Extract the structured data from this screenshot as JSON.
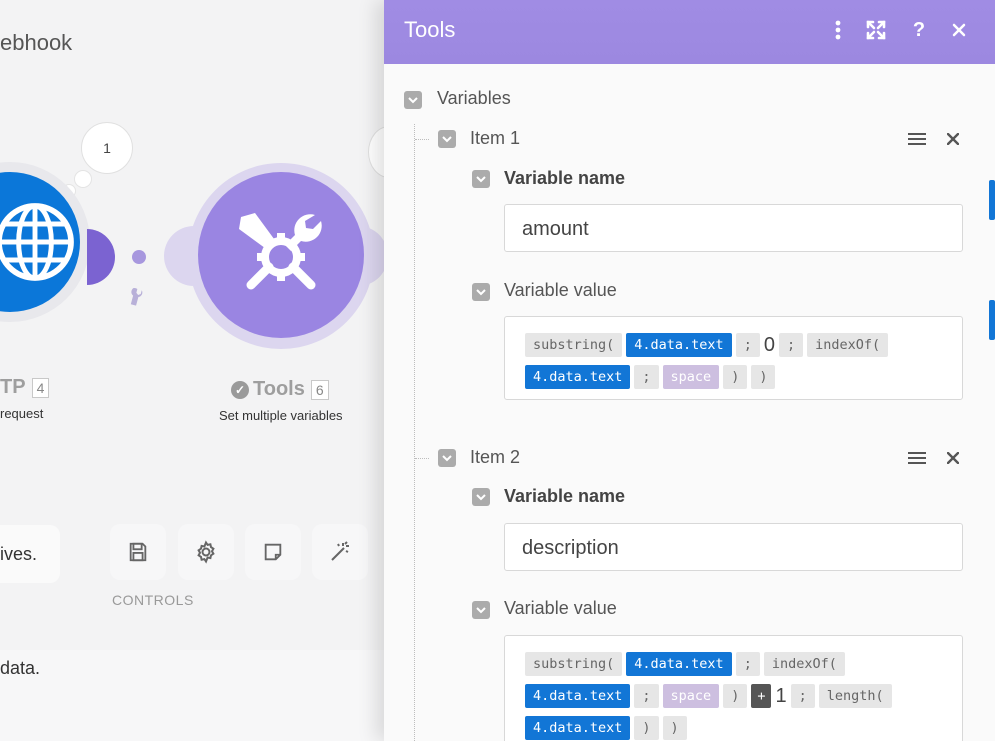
{
  "canvas": {
    "scenario_title": "ebhook",
    "bubble_count": "1",
    "http_module": {
      "name": "TP",
      "id": "4",
      "description": "request"
    },
    "tools_module": {
      "name": "Tools",
      "id": "6",
      "description": "Set multiple variables"
    },
    "toast_text": "ives.",
    "controls_label": "CONTROLS",
    "bottom_text": "data.",
    "icons": [
      "globe-icon",
      "tools-icon",
      "wrench-icon",
      "save-icon",
      "gear-icon",
      "note-icon",
      "magic-wand-icon"
    ]
  },
  "panel": {
    "title": "Tools",
    "header_icons": [
      "more-vertical-icon",
      "expand-icon",
      "help-icon",
      "close-icon"
    ],
    "variables_label": "Variables",
    "items": [
      {
        "label": "Item 1",
        "name_label": "Variable name",
        "name_value": "amount",
        "value_label": "Variable value",
        "formula": [
          {
            "t": "fn",
            "v": "substring("
          },
          {
            "t": "var",
            "v": "4.data.text"
          },
          {
            "t": "fn",
            "v": ";"
          },
          {
            "t": "lit",
            "v": "0"
          },
          {
            "t": "fn",
            "v": ";"
          },
          {
            "t": "fn",
            "v": "indexOf("
          },
          {
            "t": "var",
            "v": "4.data.text"
          },
          {
            "t": "fn",
            "v": ";"
          },
          {
            "t": "kw",
            "v": "space"
          },
          {
            "t": "fn",
            "v": ")"
          },
          {
            "t": "fn",
            "v": ")"
          }
        ]
      },
      {
        "label": "Item 2",
        "name_label": "Variable name",
        "name_value": "description",
        "value_label": "Variable value",
        "formula": [
          {
            "t": "fn",
            "v": "substring("
          },
          {
            "t": "var",
            "v": "4.data.text"
          },
          {
            "t": "fn",
            "v": ";"
          },
          {
            "t": "fn",
            "v": "indexOf("
          },
          {
            "t": "var",
            "v": "4.data.text"
          },
          {
            "t": "fn",
            "v": ";"
          },
          {
            "t": "kw",
            "v": "space"
          },
          {
            "t": "fn",
            "v": ")"
          },
          {
            "t": "op",
            "v": "+"
          },
          {
            "t": "lit",
            "v": "1"
          },
          {
            "t": "fn",
            "v": ";"
          },
          {
            "t": "fn",
            "v": "length("
          },
          {
            "t": "var",
            "v": "4.data.text"
          },
          {
            "t": "fn",
            "v": ")"
          },
          {
            "t": "fn",
            "v": ")"
          }
        ]
      }
    ]
  },
  "colors": {
    "header": "#9c88e0",
    "variable_token": "#1276d6",
    "function_token": "#e6e6e6",
    "keyword_token": "#cdbfe0",
    "operator_token": "#555555",
    "http_module": "#0b77d9",
    "tools_module": "#9a85e2"
  }
}
